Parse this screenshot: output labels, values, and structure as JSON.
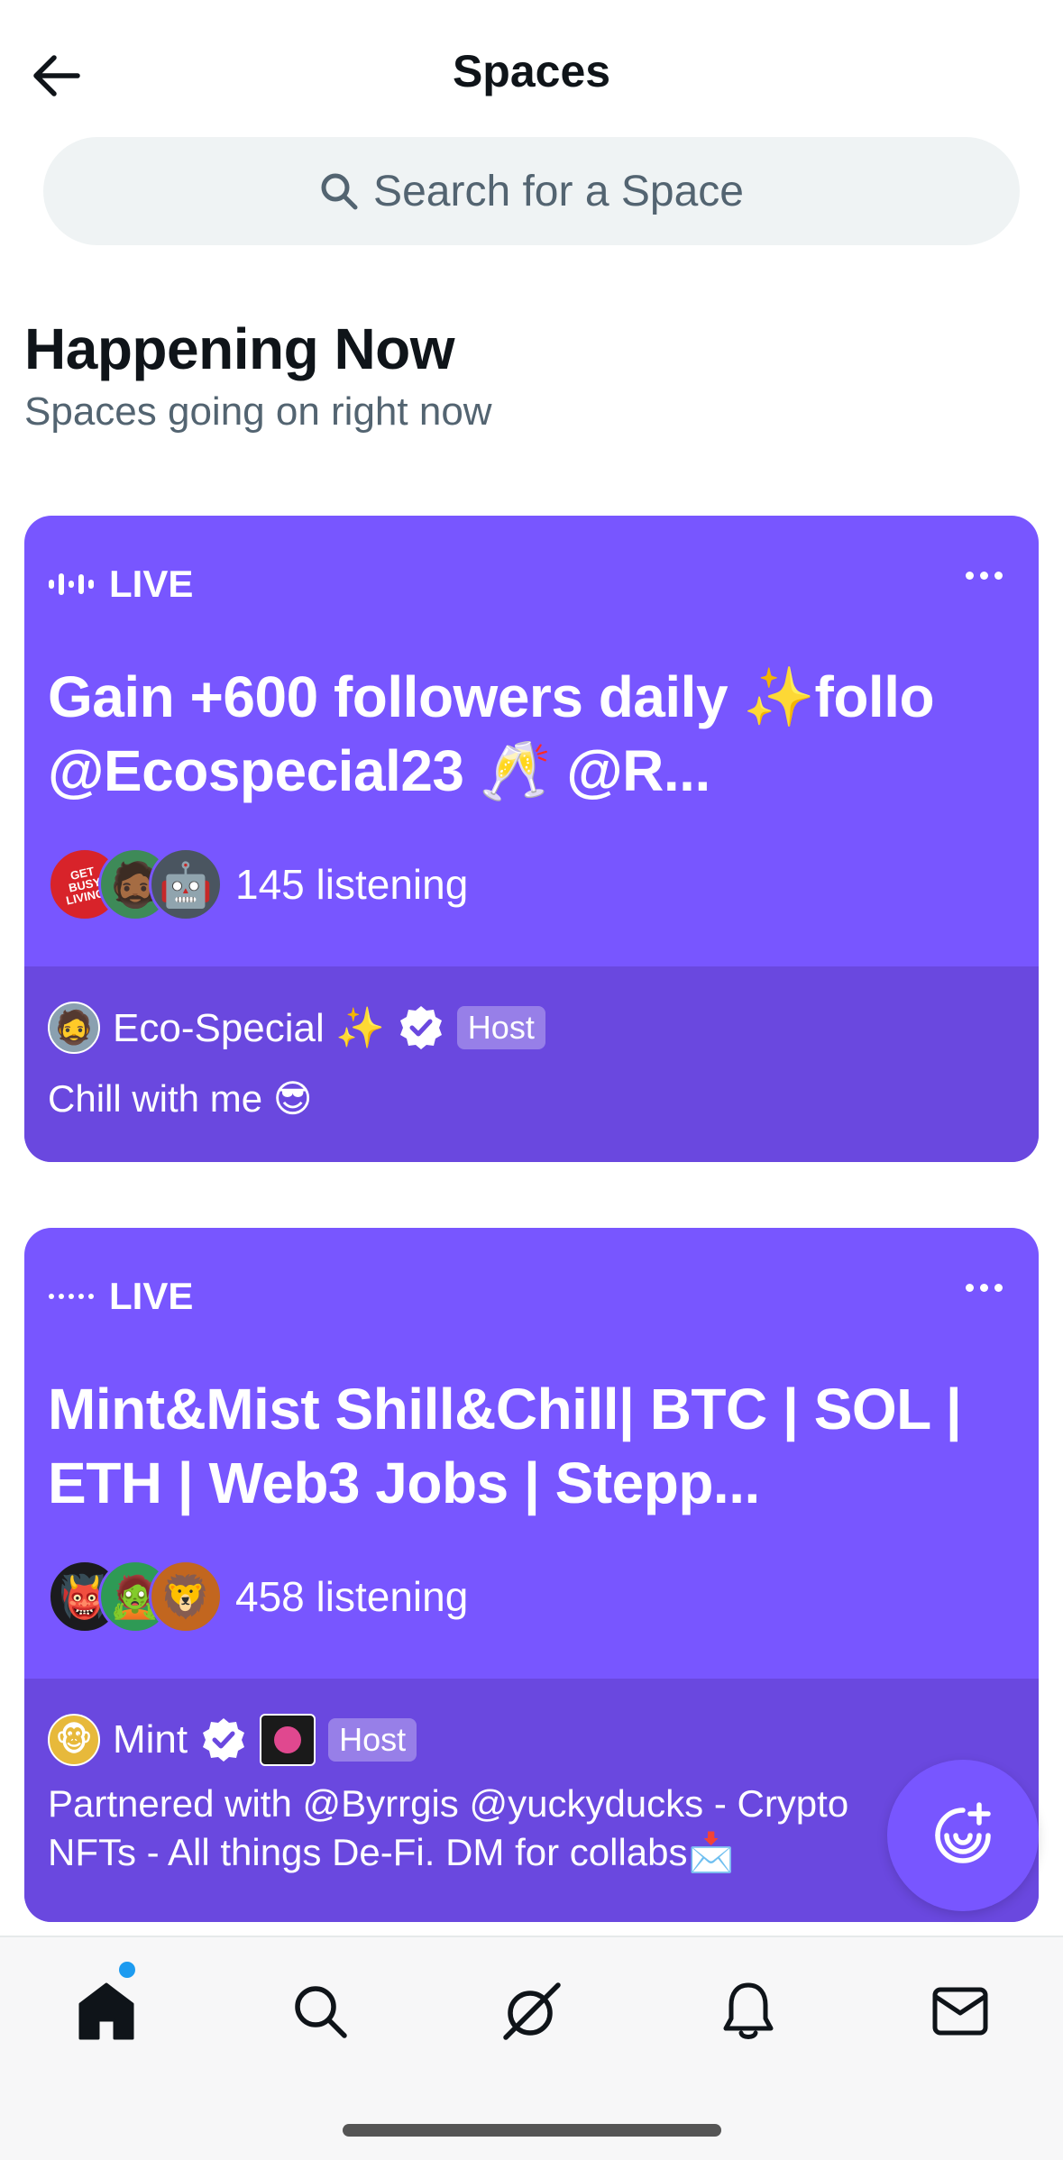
{
  "header": {
    "title": "Spaces"
  },
  "search": {
    "placeholder": "Search for a Space"
  },
  "section": {
    "title": "Happening Now",
    "subtitle": "Spaces going on right now"
  },
  "colors": {
    "accent": "#7856ff",
    "accent_dark": "#6a48df",
    "verified": "#1d9bf0"
  },
  "spaces": [
    {
      "status": "LIVE",
      "title": "Gain +600 followers daily ✨follo @Ecospecial23 🥂 @R...",
      "listeners": "145 listening",
      "host": {
        "name": "Eco-Special ✨",
        "role": "Host",
        "avatar_text": "🧔"
      },
      "listener_avatars": [
        "GET BUSY LIVING!",
        "🧔🏾",
        "🤖"
      ],
      "description": "Chill with me 😎"
    },
    {
      "status": "LIVE",
      "title": "Mint&Mist Shill&Chill| BTC | SOL | ETH | Web3 Jobs | Stepp...",
      "listeners": "458 listening",
      "host": {
        "name": "Mint",
        "role": "Host",
        "avatar_text": "🐵"
      },
      "listener_avatars": [
        "👹",
        "🧟",
        "🦁"
      ],
      "description": "Partnered with @Byrrgis @yuckyducks - Crypto NFTs - All things De-Fi. DM for collabs📩"
    }
  ],
  "tabbar": {
    "items": [
      "home-icon",
      "search-icon",
      "grok-icon",
      "notifications-icon",
      "messages-icon"
    ]
  }
}
